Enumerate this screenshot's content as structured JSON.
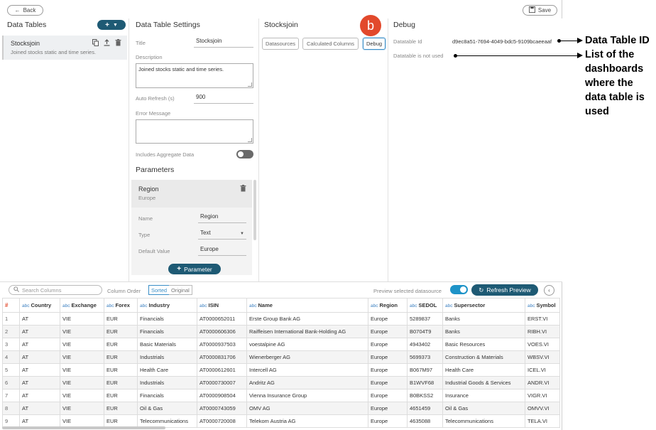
{
  "topbar": {
    "back_label": "Back",
    "save_label": "Save"
  },
  "data_tables": {
    "title": "Data Tables",
    "add_label": "+",
    "item": {
      "name": "Stocksjoin",
      "description": "Joined stocks static and time series."
    }
  },
  "settings": {
    "title": "Data Table Settings",
    "title_label": "Title",
    "title_value": "Stocksjoin",
    "description_label": "Description",
    "description_value": "Joined stocks static and time series.",
    "auto_refresh_label": "Auto Refresh (s)",
    "auto_refresh_value": "900",
    "error_label": "Error Message",
    "aggregate_label": "Includes Aggregate Data",
    "parameters_title": "Parameters",
    "param": {
      "name": "Region",
      "sub": "Europe",
      "name_label": "Name",
      "name_value": "Region",
      "type_label": "Type",
      "type_value": "Text",
      "default_label": "Default Value",
      "default_value": "Europe"
    },
    "add_param_label": "Parameter"
  },
  "stocksjoin": {
    "title": "Stocksjoin",
    "tabs": [
      "Datasources",
      "Calculated Columns",
      "Debug"
    ],
    "badge": "b"
  },
  "debug": {
    "title": "Debug",
    "id_label": "Datatable Id",
    "id_value": "d9ec8a51-7694-4049-bdc5-9109bcaeeaaf",
    "usage_text": "Datatable is not used"
  },
  "grid_tools": {
    "search_placeholder": "Search Columns",
    "column_order_label": "Column Order",
    "sorted_label": "Sorted",
    "original_label": "Original",
    "preview_label": "Preview selected datasource",
    "refresh_label": "Refresh Preview"
  },
  "table": {
    "type_tag": "abc",
    "columns": [
      "#",
      "Country",
      "Exchange",
      "Forex",
      "Industry",
      "ISIN",
      "Name",
      "Region",
      "SEDOL",
      "Supersector",
      "Symbol"
    ],
    "rows": [
      [
        "1",
        "AT",
        "VIE",
        "EUR",
        "Financials",
        "AT0000652011",
        "Erste Group Bank AG",
        "Europe",
        "5289837",
        "Banks",
        "ERST.VI"
      ],
      [
        "2",
        "AT",
        "VIE",
        "EUR",
        "Financials",
        "AT0000606306",
        "Raiffeisen International Bank-Holding AG",
        "Europe",
        "B0704T9",
        "Banks",
        "RIBH.VI"
      ],
      [
        "3",
        "AT",
        "VIE",
        "EUR",
        "Basic Materials",
        "AT0000937503",
        "voestalpine AG",
        "Europe",
        "4943402",
        "Basic Resources",
        "VOES.VI"
      ],
      [
        "4",
        "AT",
        "VIE",
        "EUR",
        "Industrials",
        "AT0000831706",
        "Wienerberger AG",
        "Europe",
        "5699373",
        "Construction & Materials",
        "WBSV.VI"
      ],
      [
        "5",
        "AT",
        "VIE",
        "EUR",
        "Health Care",
        "AT0000612601",
        "Intercell AG",
        "Europe",
        "B067M97",
        "Health Care",
        "ICEL.VI"
      ],
      [
        "6",
        "AT",
        "VIE",
        "EUR",
        "Industrials",
        "AT0000730007",
        "Andritz AG",
        "Europe",
        "B1WVF68",
        "Industrial Goods & Services",
        "ANDR.VI"
      ],
      [
        "7",
        "AT",
        "VIE",
        "EUR",
        "Financials",
        "AT0000908504",
        "Vienna Insurance Group",
        "Europe",
        "B0BKSS2",
        "Insurance",
        "VIGR.VI"
      ],
      [
        "8",
        "AT",
        "VIE",
        "EUR",
        "Oil & Gas",
        "AT0000743059",
        "OMV AG",
        "Europe",
        "4651459",
        "Oil & Gas",
        "OMVV.VI"
      ],
      [
        "9",
        "AT",
        "VIE",
        "EUR",
        "Telecommunications",
        "AT0000720008",
        "Telekom Austria AG",
        "Europe",
        "4635088",
        "Telecommunications",
        "TELA.VI"
      ]
    ]
  },
  "annotations": {
    "id_note": "Data Table ID",
    "usage_note_lines": [
      "List of the",
      "dashboards",
      "where the",
      "data table is",
      "used"
    ]
  },
  "colors": {
    "primary": "#1e5a74",
    "accent_blue": "#3a8ec7",
    "badge_red": "#e2492c"
  }
}
